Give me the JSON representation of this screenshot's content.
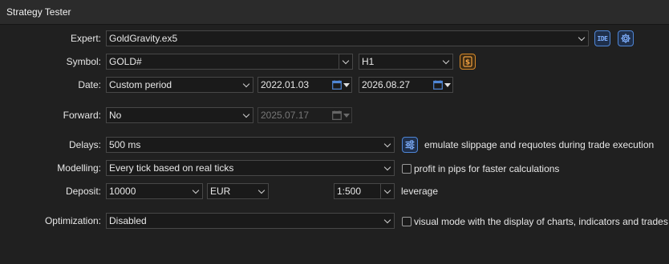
{
  "window": {
    "title": "Strategy Tester"
  },
  "expert": {
    "label": "Expert:",
    "value": "GoldGravity.ex5",
    "ide_icon_text": "IDE"
  },
  "symbol": {
    "label": "Symbol:",
    "value": "GOLD#",
    "timeframe": "H1"
  },
  "date": {
    "label": "Date:",
    "period": "Custom period",
    "from": "2022.01.03",
    "to": "2026.08.27"
  },
  "forward": {
    "label": "Forward:",
    "value": "No",
    "date": "2025.07.17"
  },
  "delays": {
    "label": "Delays:",
    "value": "500 ms",
    "note": "emulate slippage and requotes during trade execution"
  },
  "modelling": {
    "label": "Modelling:",
    "value": "Every tick based on real ticks",
    "checkbox_label": "profit in pips for faster calculations",
    "checked": false
  },
  "deposit": {
    "label": "Deposit:",
    "amount": "10000",
    "currency": "EUR",
    "leverage_value": "1:500",
    "leverage_label": "leverage"
  },
  "optimization": {
    "label": "Optimization:",
    "value": "Disabled",
    "checkbox_label": "visual mode with the display of charts, indicators and trades",
    "checked": false
  },
  "colors": {
    "icon_blue": "#4f86d6",
    "icon_orange": "#d88a2a",
    "background": "#202020"
  },
  "icons": [
    "ide-icon",
    "settings-gear-icon",
    "dollar-icon",
    "calendar-icon",
    "sliders-icon",
    "chevron-down-icon"
  ]
}
